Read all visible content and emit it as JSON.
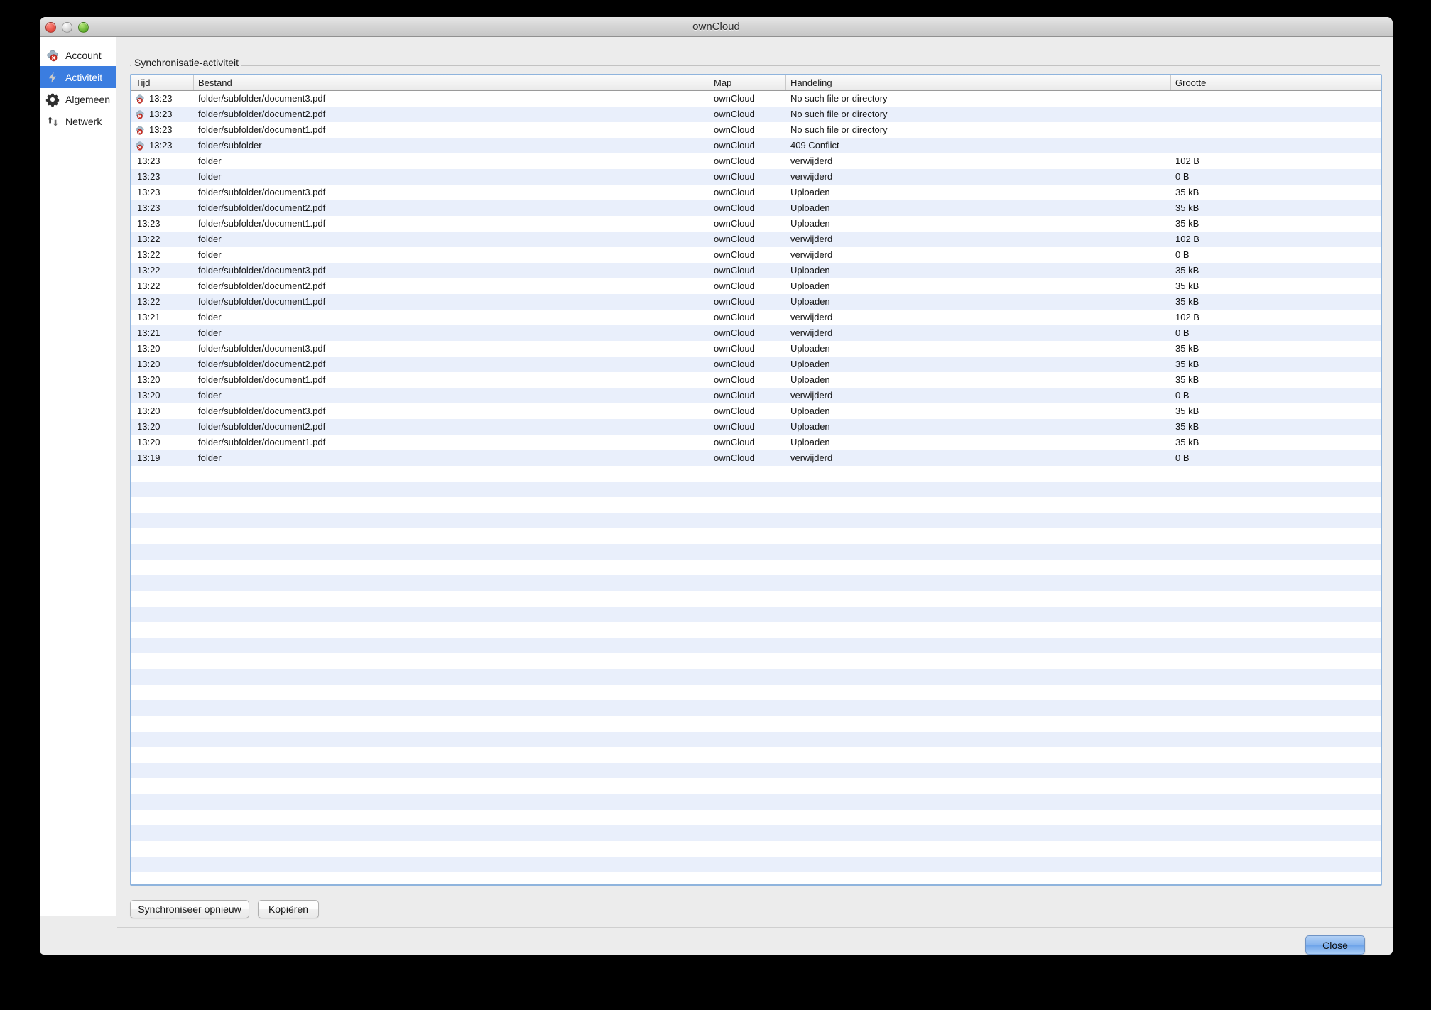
{
  "window": {
    "title": "ownCloud",
    "traffic_lights": [
      "close-light",
      "minimize-light",
      "zoom-light"
    ]
  },
  "sidebar": {
    "items": [
      {
        "label": "Account",
        "icon": "cloud-error-icon",
        "selected": false
      },
      {
        "label": "Activiteit",
        "icon": "activity-bolt-icon",
        "selected": true
      },
      {
        "label": "Algemeen",
        "icon": "gear-icon",
        "selected": false
      },
      {
        "label": "Netwerk",
        "icon": "network-arrows-icon",
        "selected": false
      }
    ]
  },
  "main": {
    "groupbox_label": "Synchronisatie-activiteit",
    "table": {
      "columns": [
        "Tijd",
        "Bestand",
        "Map",
        "Handeling",
        "Grootte"
      ],
      "rows": [
        {
          "time": "13:23",
          "error": true,
          "file": "folder/subfolder/document3.pdf",
          "folder": "ownCloud",
          "action": "No such file or directory",
          "size": ""
        },
        {
          "time": "13:23",
          "error": true,
          "file": "folder/subfolder/document2.pdf",
          "folder": "ownCloud",
          "action": "No such file or directory",
          "size": ""
        },
        {
          "time": "13:23",
          "error": true,
          "file": "folder/subfolder/document1.pdf",
          "folder": "ownCloud",
          "action": "No such file or directory",
          "size": ""
        },
        {
          "time": "13:23",
          "error": true,
          "file": "folder/subfolder",
          "folder": "ownCloud",
          "action": "409 Conflict",
          "size": ""
        },
        {
          "time": "13:23",
          "error": false,
          "file": "folder",
          "folder": "ownCloud",
          "action": "verwijderd",
          "size": "102 B"
        },
        {
          "time": "13:23",
          "error": false,
          "file": "folder",
          "folder": "ownCloud",
          "action": "verwijderd",
          "size": "0 B"
        },
        {
          "time": "13:23",
          "error": false,
          "file": "folder/subfolder/document3.pdf",
          "folder": "ownCloud",
          "action": "Uploaden",
          "size": "35 kB"
        },
        {
          "time": "13:23",
          "error": false,
          "file": "folder/subfolder/document2.pdf",
          "folder": "ownCloud",
          "action": "Uploaden",
          "size": "35 kB"
        },
        {
          "time": "13:23",
          "error": false,
          "file": "folder/subfolder/document1.pdf",
          "folder": "ownCloud",
          "action": "Uploaden",
          "size": "35 kB"
        },
        {
          "time": "13:22",
          "error": false,
          "file": "folder",
          "folder": "ownCloud",
          "action": "verwijderd",
          "size": "102 B"
        },
        {
          "time": "13:22",
          "error": false,
          "file": "folder",
          "folder": "ownCloud",
          "action": "verwijderd",
          "size": "0 B"
        },
        {
          "time": "13:22",
          "error": false,
          "file": "folder/subfolder/document3.pdf",
          "folder": "ownCloud",
          "action": "Uploaden",
          "size": "35 kB"
        },
        {
          "time": "13:22",
          "error": false,
          "file": "folder/subfolder/document2.pdf",
          "folder": "ownCloud",
          "action": "Uploaden",
          "size": "35 kB"
        },
        {
          "time": "13:22",
          "error": false,
          "file": "folder/subfolder/document1.pdf",
          "folder": "ownCloud",
          "action": "Uploaden",
          "size": "35 kB"
        },
        {
          "time": "13:21",
          "error": false,
          "file": "folder",
          "folder": "ownCloud",
          "action": "verwijderd",
          "size": "102 B"
        },
        {
          "time": "13:21",
          "error": false,
          "file": "folder",
          "folder": "ownCloud",
          "action": "verwijderd",
          "size": "0 B"
        },
        {
          "time": "13:20",
          "error": false,
          "file": "folder/subfolder/document3.pdf",
          "folder": "ownCloud",
          "action": "Uploaden",
          "size": "35 kB"
        },
        {
          "time": "13:20",
          "error": false,
          "file": "folder/subfolder/document2.pdf",
          "folder": "ownCloud",
          "action": "Uploaden",
          "size": "35 kB"
        },
        {
          "time": "13:20",
          "error": false,
          "file": "folder/subfolder/document1.pdf",
          "folder": "ownCloud",
          "action": "Uploaden",
          "size": "35 kB"
        },
        {
          "time": "13:20",
          "error": false,
          "file": "folder",
          "folder": "ownCloud",
          "action": "verwijderd",
          "size": "0 B"
        },
        {
          "time": "13:20",
          "error": false,
          "file": "folder/subfolder/document3.pdf",
          "folder": "ownCloud",
          "action": "Uploaden",
          "size": "35 kB"
        },
        {
          "time": "13:20",
          "error": false,
          "file": "folder/subfolder/document2.pdf",
          "folder": "ownCloud",
          "action": "Uploaden",
          "size": "35 kB"
        },
        {
          "time": "13:20",
          "error": false,
          "file": "folder/subfolder/document1.pdf",
          "folder": "ownCloud",
          "action": "Uploaden",
          "size": "35 kB"
        },
        {
          "time": "13:19",
          "error": false,
          "file": "folder",
          "folder": "ownCloud",
          "action": "verwijderd",
          "size": "0 B"
        }
      ],
      "empty_row_count": 28
    },
    "buttons": {
      "resync": "Synchroniseer opnieuw",
      "copy": "Kopiëren"
    }
  },
  "footer": {
    "close": "Close"
  },
  "colors": {
    "selection": "#3b7de0",
    "row_alt": "#e9effb",
    "error_badge": "#d4342a",
    "focus_ring": "#8fb4dd"
  }
}
